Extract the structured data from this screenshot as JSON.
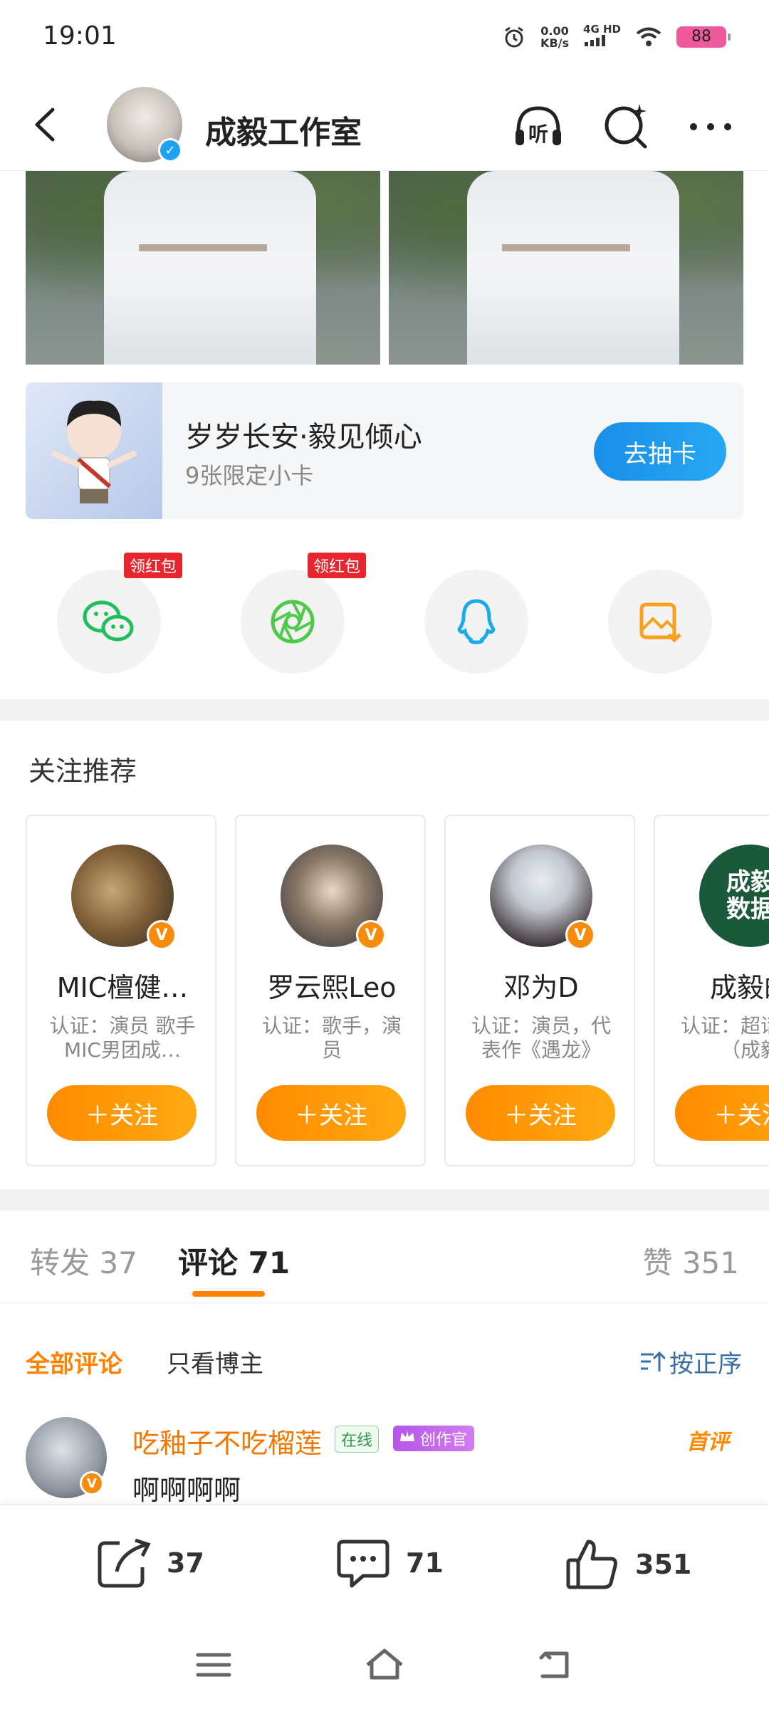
{
  "status_bar": {
    "time": "19:01",
    "net_speed_value": "0.00",
    "net_speed_unit": "KB/s",
    "net_type": "4G HD",
    "battery": "88"
  },
  "header": {
    "title": "成毅工作室",
    "listen_label": "听"
  },
  "card": {
    "title": "岁岁长安·毅见倾心",
    "subtitle": "9张限定小卡",
    "button": "去抽卡"
  },
  "share": {
    "redpack_label": "领红包"
  },
  "recommend": {
    "title": "关注推荐",
    "follow_label": "＋关注",
    "users": [
      {
        "name": "MIC檀健…",
        "desc": "认证：演员 歌手MIC男团成…"
      },
      {
        "name": "罗云熙Leo",
        "desc": "认证：歌手，演员"
      },
      {
        "name": "邓为D",
        "desc": "认证：演员，代表作《遇龙》"
      },
      {
        "name": "成毅的",
        "desc": "认证：超话钻咖（成毅",
        "avatar_text": "成毅 数据"
      }
    ]
  },
  "tabs": {
    "repost": "转发 37",
    "comment": "评论 71",
    "like": "赞 351"
  },
  "filter": {
    "all": "全部评论",
    "author_only": "只看博主",
    "sort": "按正序"
  },
  "comment": {
    "user": "吃釉子不吃榴莲",
    "online_badge": "在线",
    "creator_badge": "创作官",
    "first_badge": "首评",
    "text": "啊啊啊啊"
  },
  "actions": {
    "repost_count": "37",
    "comment_count": "71",
    "like_count": "351"
  },
  "colors": {
    "accent_orange": "#ff8200",
    "accent_blue": "#1a8fe8",
    "verified_blue": "#1da1f2",
    "verified_orange": "#f78c0c",
    "redpack_red": "#e8262f"
  }
}
